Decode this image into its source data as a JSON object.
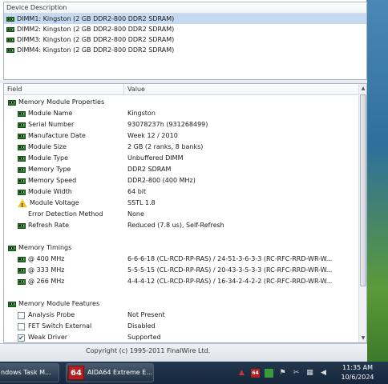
{
  "device_pane": {
    "header": "Device Description",
    "rows": [
      "DIMM1: Kingston (2 GB DDR2-800 DDR2 SDRAM)",
      "DIMM2: Kingston (2 GB DDR2-800 DDR2 SDRAM)",
      "DIMM3: Kingston (2 GB DDR2-800 DDR2 SDRAM)",
      "DIMM4: Kingston (2 GB DDR2-800 DDR2 SDRAM)"
    ]
  },
  "detail": {
    "header_field": "Field",
    "header_value": "Value",
    "properties_title": "Memory Module Properties",
    "properties": [
      {
        "field": "Module Name",
        "value": "Kingston",
        "icon": "ram-icon"
      },
      {
        "field": "Serial Number",
        "value": "93078237h (931268499)",
        "icon": "ram-icon"
      },
      {
        "field": "Manufacture Date",
        "value": "Week 12 / 2010",
        "icon": "ram-icon"
      },
      {
        "field": "Module Size",
        "value": "2 GB (2 ranks, 8 banks)",
        "icon": "ram-icon"
      },
      {
        "field": "Module Type",
        "value": "Unbuffered DIMM",
        "icon": "ram-icon"
      },
      {
        "field": "Memory Type",
        "value": "DDR2 SDRAM",
        "icon": "ram-icon"
      },
      {
        "field": "Memory Speed",
        "value": "DDR2-800 (400 MHz)",
        "icon": "ram-icon"
      },
      {
        "field": "Module Width",
        "value": "64 bit",
        "icon": "ram-icon"
      },
      {
        "field": "Module Voltage",
        "value": "SSTL 1.8",
        "icon": "warning-icon"
      },
      {
        "field": "Error Detection Method",
        "value": "None",
        "icon": "none"
      },
      {
        "field": "Refresh Rate",
        "value": "Reduced (7.8 us), Self-Refresh",
        "icon": "ram-icon"
      }
    ],
    "timings_title": "Memory Timings",
    "timings": [
      {
        "field": "@ 400 MHz",
        "value": "6-6-6-18  (CL-RCD-RP-RAS) / 24-51-3-6-3-3  (RC-RFC-RRD-WR-W..."
      },
      {
        "field": "@ 333 MHz",
        "value": "5-5-5-15  (CL-RCD-RP-RAS) / 20-43-3-5-3-3  (RC-RFC-RRD-WR-W..."
      },
      {
        "field": "@ 266 MHz",
        "value": "4-4-4-12  (CL-RCD-RP-RAS) / 16-34-2-4-2-2  (RC-RFC-RRD-WR-W..."
      }
    ],
    "features_title": "Memory Module Features",
    "features": [
      {
        "field": "Analysis Probe",
        "value": "Not Present",
        "checked": false
      },
      {
        "field": "FET Switch External",
        "value": "Disabled",
        "checked": false
      },
      {
        "field": "Weak Driver",
        "value": "Supported",
        "checked": true
      }
    ]
  },
  "statusbar": {
    "text": "Copyright (c) 1995-2011 FinalWire Ltd."
  },
  "taskbar": {
    "task_manager_label": "ndows Task M...",
    "aida_label": "AIDA64 Extreme E...",
    "aida_icon_text": "64",
    "tray_aida_text": "64",
    "clock_time": "11:35 AM",
    "clock_date": "10/6/2024"
  }
}
